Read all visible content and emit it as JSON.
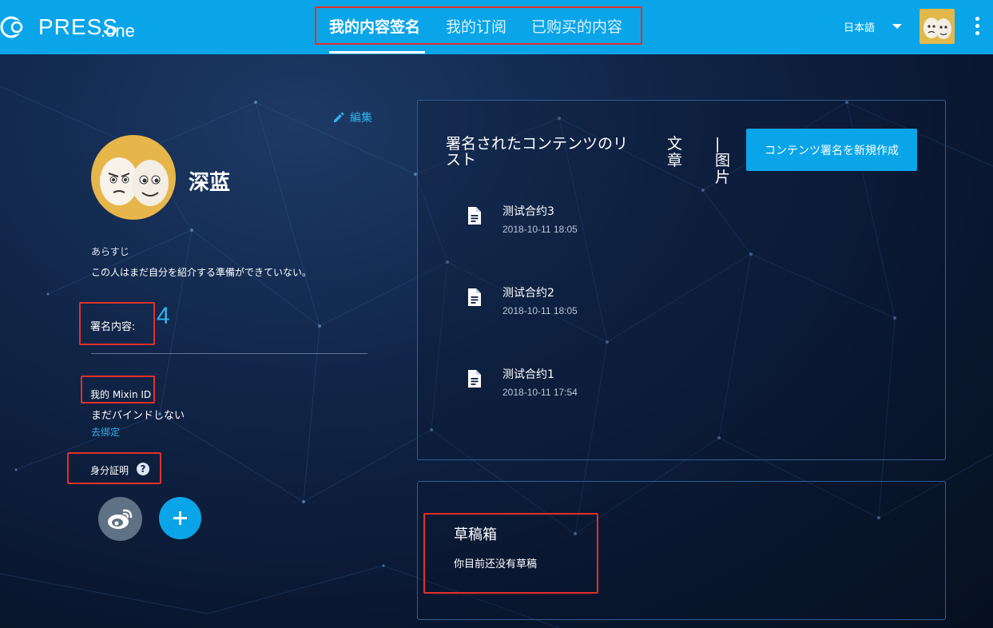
{
  "header": {
    "brand": "PRESS",
    "brand_suffix": ".one",
    "nav": [
      {
        "label": "我的内容签名",
        "active": true
      },
      {
        "label": "我的订阅",
        "active": false
      },
      {
        "label": "已购买的内容",
        "active": false
      }
    ],
    "language": "日本語"
  },
  "profile": {
    "edit_label": "編集",
    "name": "深蓝",
    "bio_label": "あらすじ",
    "bio_text": "この人はまだ自分を紹介する準備ができていない。",
    "signatures_label": "署名内容:",
    "signatures_count": "4",
    "mixin_label": "我的 Mixin ID",
    "mixin_status": "まだバインドしない",
    "mixin_action": "去绑定",
    "identity_label": "身分証明",
    "help_glyph": "?"
  },
  "content_list": {
    "title": "署名されたコンテンツのリスト",
    "tab_article": "文章",
    "tab_image": "|图片",
    "new_button": "コンテンツ署名を新規作成",
    "items": [
      {
        "name": "测试合约3",
        "date": "2018-10-11 18:05"
      },
      {
        "name": "测试合约2",
        "date": "2018-10-11 18:05"
      },
      {
        "name": "测试合约1",
        "date": "2018-10-11 17:54"
      }
    ]
  },
  "drafts": {
    "title": "草稿箱",
    "empty_text": "你目前还没有草稿"
  },
  "colors": {
    "topbar": "#0aa5e8",
    "accent": "#32b2ee",
    "annotation": "#e3302a",
    "panel_border": "#2c5f95"
  },
  "icons": {
    "logo": "press-logo-icon",
    "dropdown": "caret-down-icon",
    "more": "kebab-menu-icon",
    "edit": "pencil-icon",
    "help": "question-circle-icon",
    "weibo": "weibo-icon",
    "add": "plus-icon",
    "document": "document-icon"
  }
}
